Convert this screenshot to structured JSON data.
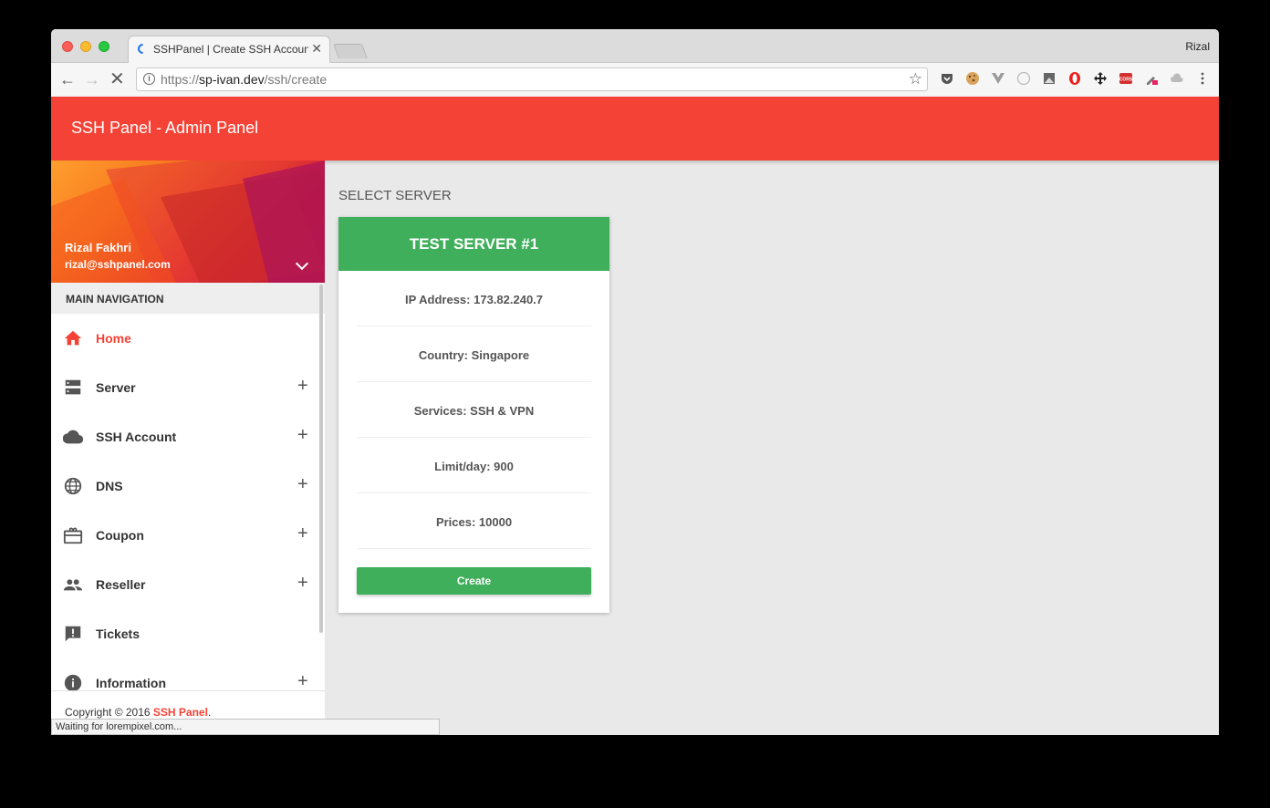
{
  "browser": {
    "tab_title": "SSHPanel | Create SSH Account",
    "tab_close": "✕",
    "profile_name": "Rizal",
    "url_protocol": "https://",
    "url_host": "sp-ivan.dev",
    "url_path": "/ssh/create",
    "status_text": "Waiting for lorempixel.com..."
  },
  "header": {
    "title": "SSH Panel - Admin Panel"
  },
  "user": {
    "name": "Rizal Fakhri",
    "email": "rizal@sshpanel.com"
  },
  "sidebar": {
    "section_label": "MAIN NAVIGATION",
    "items": [
      {
        "label": "Home",
        "icon": "home-icon",
        "active": true,
        "expandable": false
      },
      {
        "label": "Server",
        "icon": "server-icon",
        "active": false,
        "expandable": true
      },
      {
        "label": "SSH Account",
        "icon": "cloud-icon",
        "active": false,
        "expandable": true
      },
      {
        "label": "DNS",
        "icon": "globe-icon",
        "active": false,
        "expandable": true
      },
      {
        "label": "Coupon",
        "icon": "gift-card-icon",
        "active": false,
        "expandable": true
      },
      {
        "label": "Reseller",
        "icon": "people-icon",
        "active": false,
        "expandable": true
      },
      {
        "label": "Tickets",
        "icon": "feedback-icon",
        "active": false,
        "expandable": false
      },
      {
        "label": "Information",
        "icon": "info-icon",
        "active": false,
        "expandable": true
      }
    ],
    "expand_symbol": "+",
    "copyright_prefix": "Copyright © 2016 ",
    "copyright_brand": "SSH Panel",
    "copyright_suffix": "."
  },
  "main": {
    "section_title": "SELECT SERVER",
    "server_card": {
      "title": "TEST SERVER #1",
      "ip": "IP Address: 173.82.240.7",
      "country": "Country: Singapore",
      "services": "Services: SSH & VPN",
      "limit": "Limit/day: 900",
      "prices": "Prices: 10000",
      "button_label": "Create"
    }
  },
  "colors": {
    "primary_red": "#f44336",
    "success_green": "#3faf5b"
  }
}
